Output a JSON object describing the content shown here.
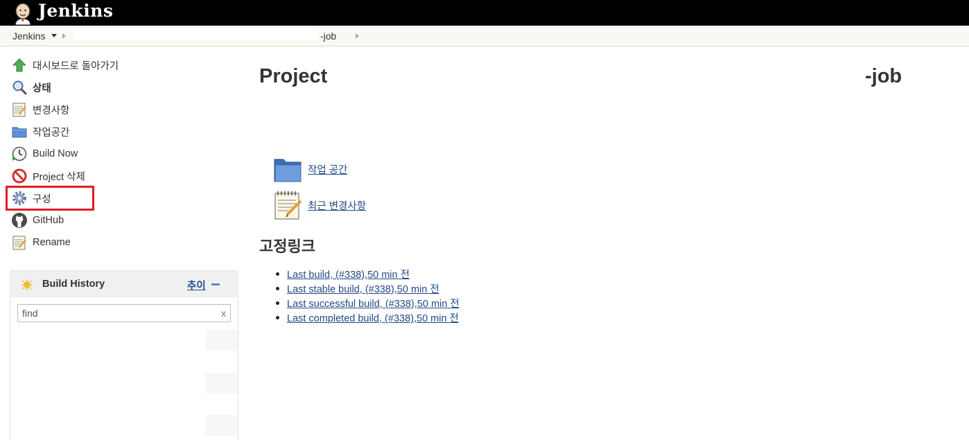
{
  "header": {
    "brand": "Jenkins"
  },
  "breadcrumbs": {
    "root": "Jenkins",
    "job_suffix": "-job"
  },
  "sidebar": {
    "items": [
      {
        "label": "대시보드로 돌아가기",
        "icon": "up-arrow-icon"
      },
      {
        "label": "상태",
        "icon": "search-icon"
      },
      {
        "label": "변경사항",
        "icon": "notepad-icon"
      },
      {
        "label": "작업공간",
        "icon": "folder-icon"
      },
      {
        "label": "Build Now",
        "icon": "build-clock-icon"
      },
      {
        "label": "Project 삭제",
        "icon": "no-entry-icon"
      },
      {
        "label": "구성",
        "icon": "gear-icon"
      },
      {
        "label": "GitHub",
        "icon": "github-icon"
      },
      {
        "label": "Rename",
        "icon": "notepad-icon"
      }
    ],
    "highlight_color": "#e01b24"
  },
  "build_history": {
    "title": "Build History",
    "trend_label": "추이",
    "find_value": "find",
    "clear_label": "x"
  },
  "main": {
    "title_prefix": "Project",
    "title_suffix": "-job",
    "workspace_link": "작업 공간",
    "changes_link": "최근 변경사항",
    "permalinks_title": "고정링크",
    "permalinks": [
      "Last build, (#338),50 min 전",
      "Last stable build, (#338),50 min 전",
      "Last successful build, (#338),50 min 전",
      "Last completed build, (#338),50 min 전"
    ]
  },
  "colors": {
    "header_bg": "#000000",
    "breadcrumb_bg": "#f6faf2",
    "link": "#204a87"
  }
}
